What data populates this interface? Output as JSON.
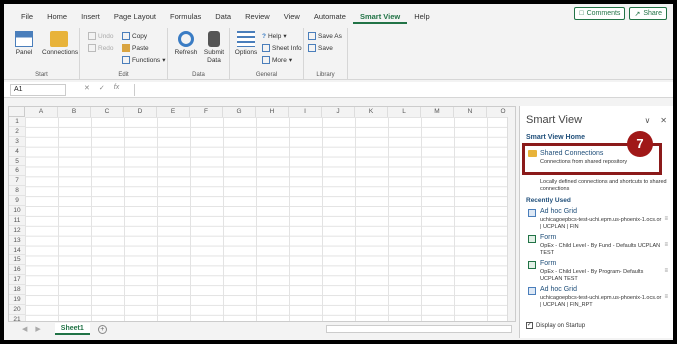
{
  "ribbon_tabs": [
    "File",
    "Home",
    "Insert",
    "Page Layout",
    "Formulas",
    "Data",
    "Review",
    "View",
    "Automate",
    "Smart View",
    "Help"
  ],
  "active_tab": "Smart View",
  "comments_label": "Comments",
  "share_label": "Share",
  "ribbon": {
    "panel_label": "Panel",
    "connections_label": "Connections",
    "start_group": "Start",
    "undo_label": "Undo",
    "redo_label": "Redo",
    "copy_label": "Copy",
    "paste_label": "Paste",
    "functions_label": "Functions",
    "edit_group": "Edit",
    "refresh_label": "Refresh",
    "submit_label": "Submit Data",
    "data_group": "Data",
    "options_label": "Options",
    "help_label": "Help",
    "sheet_info_label": "Sheet Info",
    "more_label": "More",
    "general_group": "General",
    "save_as_label": "Save As",
    "save_label": "Save",
    "library_group": "Library"
  },
  "formula_bar": {
    "name_box": "A1",
    "fx": "fx"
  },
  "columns": [
    "A",
    "B",
    "C",
    "D",
    "E",
    "F",
    "G",
    "H",
    "I",
    "J",
    "K",
    "L",
    "M",
    "N",
    "O"
  ],
  "rows": [
    "1",
    "2",
    "3",
    "4",
    "5",
    "6",
    "7",
    "8",
    "9",
    "10",
    "11",
    "12",
    "13",
    "14",
    "15",
    "16",
    "17",
    "18",
    "19",
    "20",
    "21"
  ],
  "sheet_tab": "Sheet1",
  "smart_view": {
    "title": "Smart View",
    "home_link": "Smart View Home",
    "shared_connections_title": "Shared Connections",
    "shared_connections_sub": "Connections from shared repository",
    "local_text": "Locally defined connections and shortcuts to shared connections",
    "recently_used_label": "Recently Used",
    "display_on_startup": "Display on Startup",
    "recent": [
      {
        "title": "Ad hoc Grid",
        "desc": "uchicagoepbcs-test-uchi.epm.us-phoenix-1.ocs.or | UCPLAN | FIN"
      },
      {
        "title": "Form",
        "desc": "OpEx - Child Level - By Fund - Defaults UCPLAN TEST"
      },
      {
        "title": "Form",
        "desc": "OpEx - Child Level - By Program- Defaults UCPLAN TEST"
      },
      {
        "title": "Ad hoc Grid",
        "desc": "uchicagoepbcs-test-uchi.epm.us-phoenix-1.ocs.or | UCPLAN | FIN_RPT"
      }
    ]
  },
  "step_badge": "7"
}
